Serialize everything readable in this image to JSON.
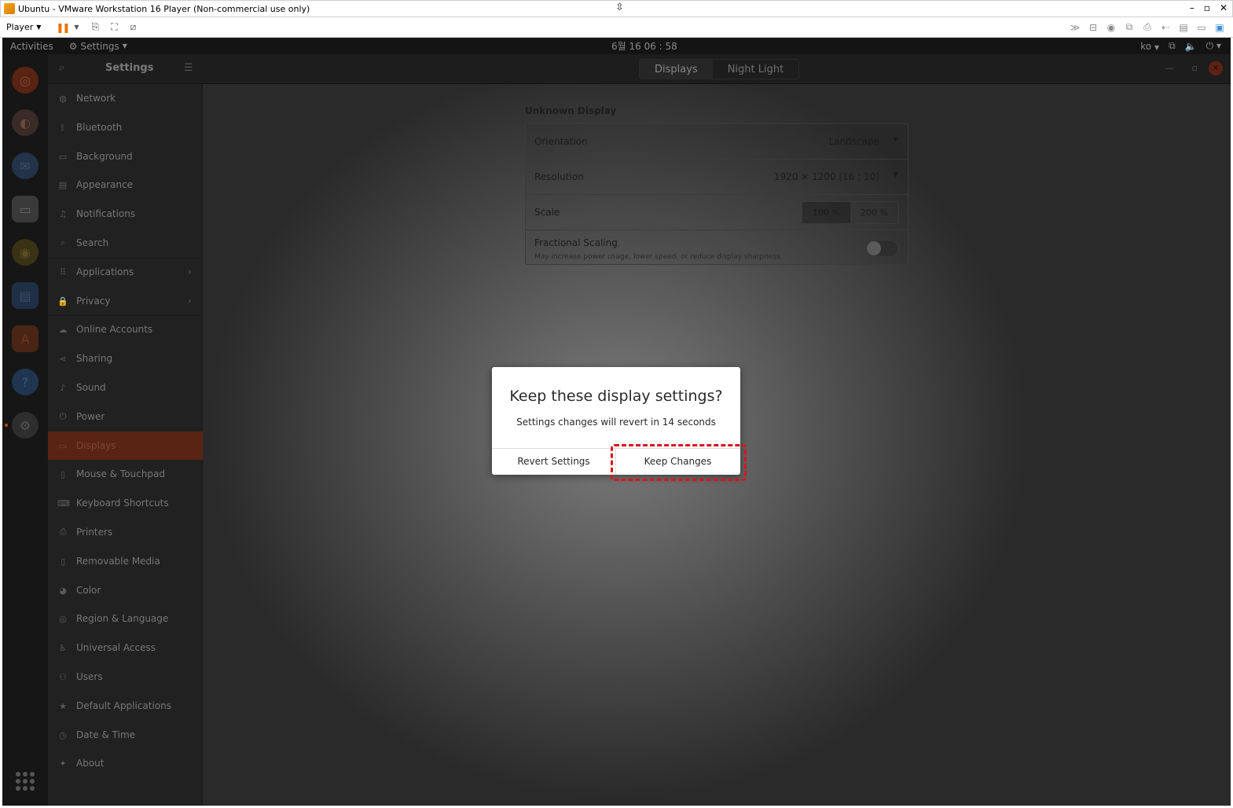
{
  "vm_window": {
    "title": "Ubuntu - VMware Workstation 16 Player (Non-commercial use only)",
    "player_menu": "Player",
    "window_controls": [
      "–",
      "▫",
      "✕"
    ]
  },
  "topbar": {
    "activities": "Activities",
    "app_menu": "Settings",
    "clock": "6월 16 06 : 58",
    "lang": "ko"
  },
  "header": {
    "title": "Settings",
    "tabs": [
      {
        "label": "Displays",
        "active": true
      },
      {
        "label": "Night Light",
        "active": false
      }
    ]
  },
  "sidebar": {
    "items": [
      {
        "label": "Network",
        "icon": "network-icon",
        "glyph": "◍"
      },
      {
        "label": "Bluetooth",
        "icon": "bluetooth-icon",
        "glyph": "ᛒ"
      },
      {
        "label": "Background",
        "icon": "background-icon",
        "glyph": "▭"
      },
      {
        "label": "Appearance",
        "icon": "appearance-icon",
        "glyph": "▤"
      },
      {
        "label": "Notifications",
        "icon": "bell-icon",
        "glyph": "♫"
      },
      {
        "label": "Search",
        "icon": "search-icon",
        "glyph": "⌕"
      },
      {
        "label": "Applications",
        "icon": "grid-icon",
        "glyph": "⠿",
        "has_arrow": true
      },
      {
        "label": "Privacy",
        "icon": "lock-icon",
        "glyph": "🔒",
        "has_arrow": true
      },
      {
        "label": "Online Accounts",
        "icon": "cloud-icon",
        "glyph": "☁"
      },
      {
        "label": "Sharing",
        "icon": "share-icon",
        "glyph": "⋖"
      },
      {
        "label": "Sound",
        "icon": "music-note-icon",
        "glyph": "♪"
      },
      {
        "label": "Power",
        "icon": "power-icon",
        "glyph": "⏻"
      },
      {
        "label": "Displays",
        "icon": "display-icon",
        "glyph": "▭",
        "active": true
      },
      {
        "label": "Mouse & Touchpad",
        "icon": "mouse-icon",
        "glyph": "▯"
      },
      {
        "label": "Keyboard Shortcuts",
        "icon": "keyboard-icon",
        "glyph": "⌨"
      },
      {
        "label": "Printers",
        "icon": "printer-icon",
        "glyph": "⎙"
      },
      {
        "label": "Removable Media",
        "icon": "usb-icon",
        "glyph": "▯"
      },
      {
        "label": "Color",
        "icon": "color-icon",
        "glyph": "◕"
      },
      {
        "label": "Region & Language",
        "icon": "globe-icon",
        "glyph": "◎"
      },
      {
        "label": "Universal Access",
        "icon": "accessibility-icon",
        "glyph": "♿"
      },
      {
        "label": "Users",
        "icon": "users-icon",
        "glyph": "⚇"
      },
      {
        "label": "Default Applications",
        "icon": "star-icon",
        "glyph": "★"
      },
      {
        "label": "Date & Time",
        "icon": "clock-icon",
        "glyph": "◷"
      },
      {
        "label": "About",
        "icon": "info-icon",
        "glyph": "✦"
      }
    ]
  },
  "displays": {
    "heading": "Unknown Display",
    "orientation_label": "Orientation",
    "orientation_value": "Landscape",
    "resolution_label": "Resolution",
    "resolution_value": "1920 × 1200 (16 : 10)",
    "scale_label": "Scale",
    "scale_options": [
      "100 %",
      "200 %"
    ],
    "scale_selected": "100 %",
    "fractional_label": "Fractional Scaling",
    "fractional_sub": "May increase power usage, lower speed, or reduce display sharpness.",
    "fractional_enabled": false
  },
  "dialog": {
    "title": "Keep these display settings?",
    "message": "Settings changes will revert in 14 seconds",
    "revert_label": "Revert Settings",
    "keep_label": "Keep Changes"
  },
  "colors": {
    "accent": "#e95420",
    "highlight": "#d9141f",
    "vmware_pause": "#e8730c"
  }
}
